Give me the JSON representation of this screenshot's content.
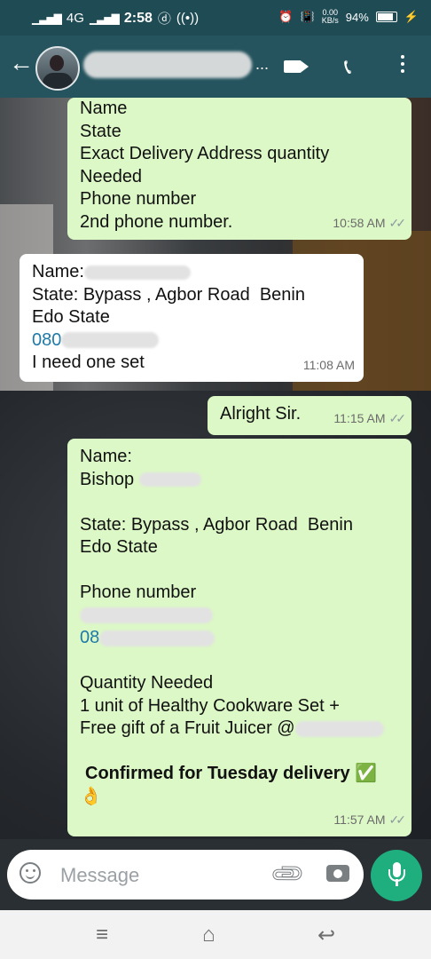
{
  "status_bar": {
    "network": "4G",
    "time": "2:58",
    "speed_value": "0.00",
    "speed_unit": "KB/s",
    "battery": "94%"
  },
  "header": {
    "contact_name": "...",
    "icons": [
      "back-arrow-icon",
      "avatar",
      "video-call-icon",
      "phone-icon",
      "more-vert-icon"
    ]
  },
  "messages": [
    {
      "direction": "out",
      "lines": [
        "Name",
        "State",
        "Exact Delivery Address quantity",
        "Needed",
        "Phone number",
        "2nd phone number."
      ],
      "time": "10:58 AM"
    },
    {
      "direction": "in",
      "lines": [
        "Name:",
        "State: Bypass , Agbor Road  Benin",
        "Edo State",
        "080",
        "I need one set"
      ],
      "time": "11:08 AM"
    },
    {
      "direction": "out",
      "lines": [
        "Alright Sir."
      ],
      "time": "11:15 AM"
    },
    {
      "direction": "out",
      "lines": [
        "Name:",
        "Bishop",
        "",
        "State: Bypass , Agbor Road  Benin",
        "Edo State",
        "",
        "Phone number",
        "",
        "08",
        "",
        "Quantity Needed",
        "1 unit of Healthy Cookware Set +",
        "Free gift of a Fruit Juicer @",
        "",
        "Confirmed for Tuesday delivery ✅",
        "👌"
      ],
      "time": "11:57 AM"
    }
  ],
  "composer": {
    "placeholder": "Message"
  },
  "navbar": {
    "icons": [
      "menu-lines-icon",
      "home-icon",
      "back-icon"
    ]
  }
}
